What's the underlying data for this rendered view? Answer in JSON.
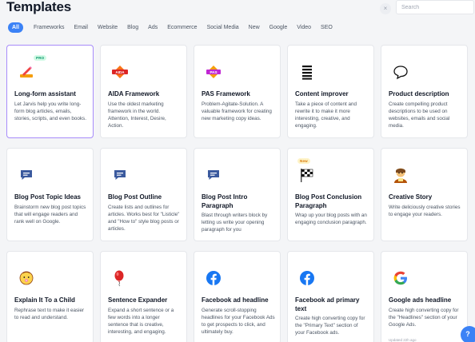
{
  "header": {
    "title": "Templates",
    "close_glyph": "×",
    "search_placeholder": "Search"
  },
  "filters": [
    "All",
    "Frameworks",
    "Email",
    "Website",
    "Blog",
    "Ads",
    "Ecommerce",
    "Social Media",
    "New",
    "Google",
    "Video",
    "SEO"
  ],
  "active_filter": "All",
  "colors": {
    "accent": "#3b82f6",
    "selected_border": "#a78bfa",
    "facebook": "#1877f2",
    "blog_icon": "#3b5a9e"
  },
  "cards": [
    {
      "title": "Long-form assistant",
      "icon": "pencil-icon",
      "badge": "PRO",
      "desc": "Let Jarvis help you write long-form blog articles, emails, stories, scripts, and even books.",
      "lines": 1
    },
    {
      "title": "AIDA Framework",
      "icon": "aida-icon",
      "icon_text": "AIDA",
      "desc": "Use the oldest marketing framework in the world. Attention, Interest, Desire, Action.",
      "lines": 1
    },
    {
      "title": "PAS Framework",
      "icon": "pas-icon",
      "icon_text": "PAS",
      "desc": "Problem-Agitate-Solution. A valuable framework for creating new marketing copy ideas.",
      "lines": 1
    },
    {
      "title": "Content improver",
      "icon": "list-icon",
      "desc": "Take a piece of content and rewrite it to make it more interesting, creative, and engaging.",
      "lines": 1
    },
    {
      "title": "Product description",
      "icon": "speech-bubble-icon",
      "desc": "Create compelling product descriptions to be used on websites, emails and social media.",
      "lines": 1
    },
    {
      "title": "Blog Post Topic Ideas",
      "icon": "blog-icon",
      "desc": "Brainstorm new blog post topics that will engage readers and rank well on Google.",
      "lines": 1
    },
    {
      "title": "Blog Post Outline",
      "icon": "blog-icon",
      "desc": "Create lists and outlines for articles. Works best for \"Listicle\" and \"How to\" style blog posts or articles.",
      "lines": 1
    },
    {
      "title": "Blog Post Intro Paragraph",
      "icon": "blog-icon",
      "desc": "Blast through writers block by letting us write your opening paragraph for you",
      "lines": 2
    },
    {
      "title": "Blog Post Conclusion Paragraph",
      "icon": "checkered-flag-icon",
      "badge": "New",
      "desc": "Wrap up your blog posts with an engaging conclusion paragraph.",
      "lines": 2
    },
    {
      "title": "Creative Story",
      "icon": "storyteller-icon",
      "desc": "Write deliciously creative stories to engage your readers.",
      "lines": 1
    },
    {
      "title": "Explain It To a Child",
      "icon": "baby-icon",
      "desc": "Rephrase text to make it easier to read and understand.",
      "lines": 1
    },
    {
      "title": "Sentence Expander",
      "icon": "balloon-icon",
      "desc": "Expand a short sentence or a few words into a longer sentence that is creative, interesting, and engaging.",
      "lines": 1
    },
    {
      "title": "Facebook ad headline",
      "icon": "facebook-icon",
      "desc": "Generate scroll-stopping headlines for your Facebook Ads to get prospects to click, and ultimately buy.",
      "lines": 1
    },
    {
      "title": "Facebook ad primary text",
      "icon": "facebook-icon",
      "desc": "Create high converting copy for the \"Primary Text\" section of your Facebook ads.",
      "lines": 2
    },
    {
      "title": "Google ads headline",
      "icon": "google-icon",
      "desc": "Create high converting copy for the \"Headlines\" section of your Google Ads.",
      "lines": 1,
      "updated": "Updated 22h ago"
    }
  ],
  "help_glyph": "?"
}
